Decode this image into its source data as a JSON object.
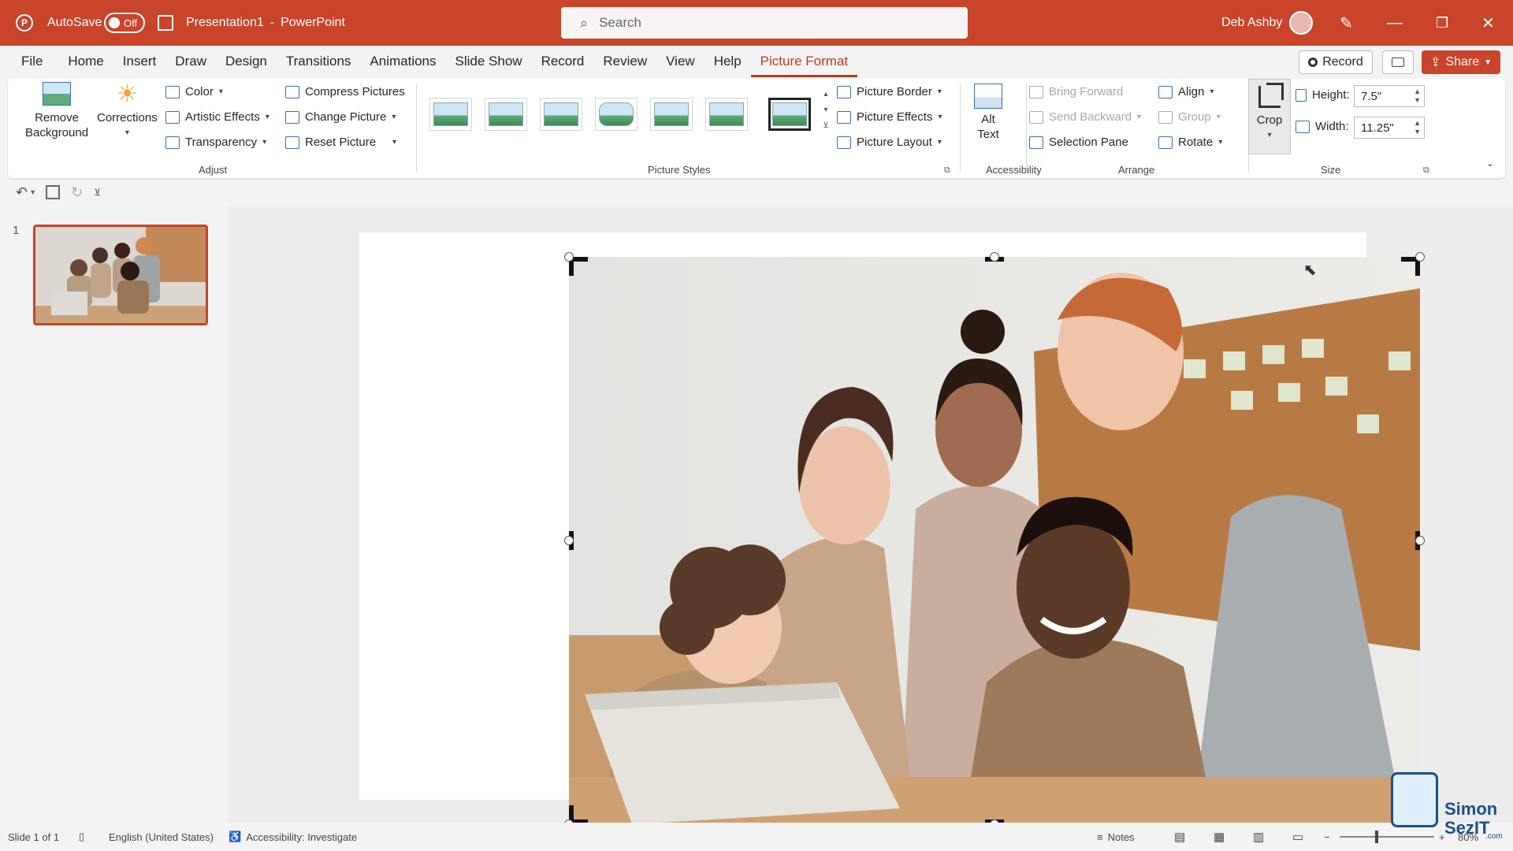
{
  "titlebar": {
    "autosave_label": "AutoSave",
    "autosave_state": "Off",
    "document": "Presentation1",
    "separator": "-",
    "app": "PowerPoint",
    "search_placeholder": "Search",
    "user": "Deb Ashby",
    "colors": {
      "accent": "#c8442a"
    }
  },
  "tabs": [
    "File",
    "Home",
    "Insert",
    "Draw",
    "Design",
    "Transitions",
    "Animations",
    "Slide Show",
    "Record",
    "Review",
    "View",
    "Help",
    "Picture Format"
  ],
  "active_tab": "Picture Format",
  "tab_buttons": {
    "record": "Record",
    "share": "Share"
  },
  "ribbon": {
    "adjust": {
      "remove_background": [
        "Remove",
        "Background"
      ],
      "corrections": "Corrections",
      "color": "Color",
      "artistic_effects": "Artistic Effects",
      "transparency": "Transparency",
      "compress": "Compress Pictures",
      "change": "Change Picture",
      "reset": "Reset Picture",
      "group_label": "Adjust"
    },
    "styles": {
      "group_label": "Picture Styles",
      "count": 7
    },
    "styles_cmds": {
      "border": "Picture Border",
      "effects": "Picture Effects",
      "layout": "Picture Layout"
    },
    "accessibility": {
      "alt_text": [
        "Alt",
        "Text"
      ],
      "group_label": "Accessibility"
    },
    "arrange": {
      "bring_forward": "Bring Forward",
      "send_backward": "Send Backward",
      "selection_pane": "Selection Pane",
      "align": "Align",
      "group": "Group",
      "rotate": "Rotate",
      "group_label": "Arrange"
    },
    "size": {
      "crop": "Crop",
      "height_label": "Height:",
      "height_value": "7.5\"",
      "width_label": "Width:",
      "width_value": "11.25\"",
      "group_label": "Size"
    }
  },
  "slides": {
    "number": "1"
  },
  "status": {
    "slide": "Slide 1 of 1",
    "language": "English (United States)",
    "accessibility": "Accessibility: Investigate",
    "notes": "Notes",
    "zoom": "80%"
  },
  "watermark": {
    "brand": "Simon",
    "brand2": "SezIT",
    "suffix": ".com"
  }
}
